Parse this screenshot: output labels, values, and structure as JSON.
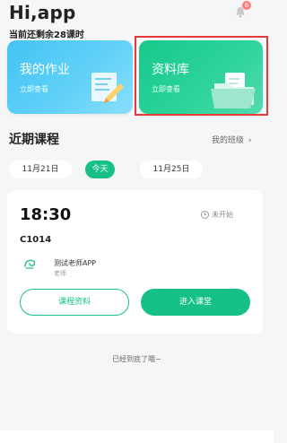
{
  "header": {
    "greeting": "Hi,app",
    "remaining": "当前还剩余28课时",
    "badge_count": "6"
  },
  "cards": {
    "homework": {
      "title": "我的作业",
      "subtitle": "立即查看"
    },
    "library": {
      "title": "资料库",
      "subtitle": "立即查看"
    }
  },
  "recent": {
    "title": "近期课程",
    "my_class": "我的班级",
    "dates": [
      "11月21日",
      "今天",
      "11月25日"
    ]
  },
  "course": {
    "time": "18:30",
    "status": "未开始",
    "code": "C1014",
    "teacher_name": "测试老师APP",
    "teacher_role": "老师",
    "btn_materials": "课程资料",
    "btn_enter": "进入课堂"
  },
  "footer": {
    "end_text": "已经到底了哦~"
  },
  "colors": {
    "accent": "#16c088",
    "homework": "#43c3f3",
    "highlight": "#e63a3a"
  },
  "icons": [
    "bell-icon",
    "homework-illustration",
    "folder-illustration",
    "clock-icon",
    "chevron-right-icon",
    "teacher-avatar-icon"
  ]
}
